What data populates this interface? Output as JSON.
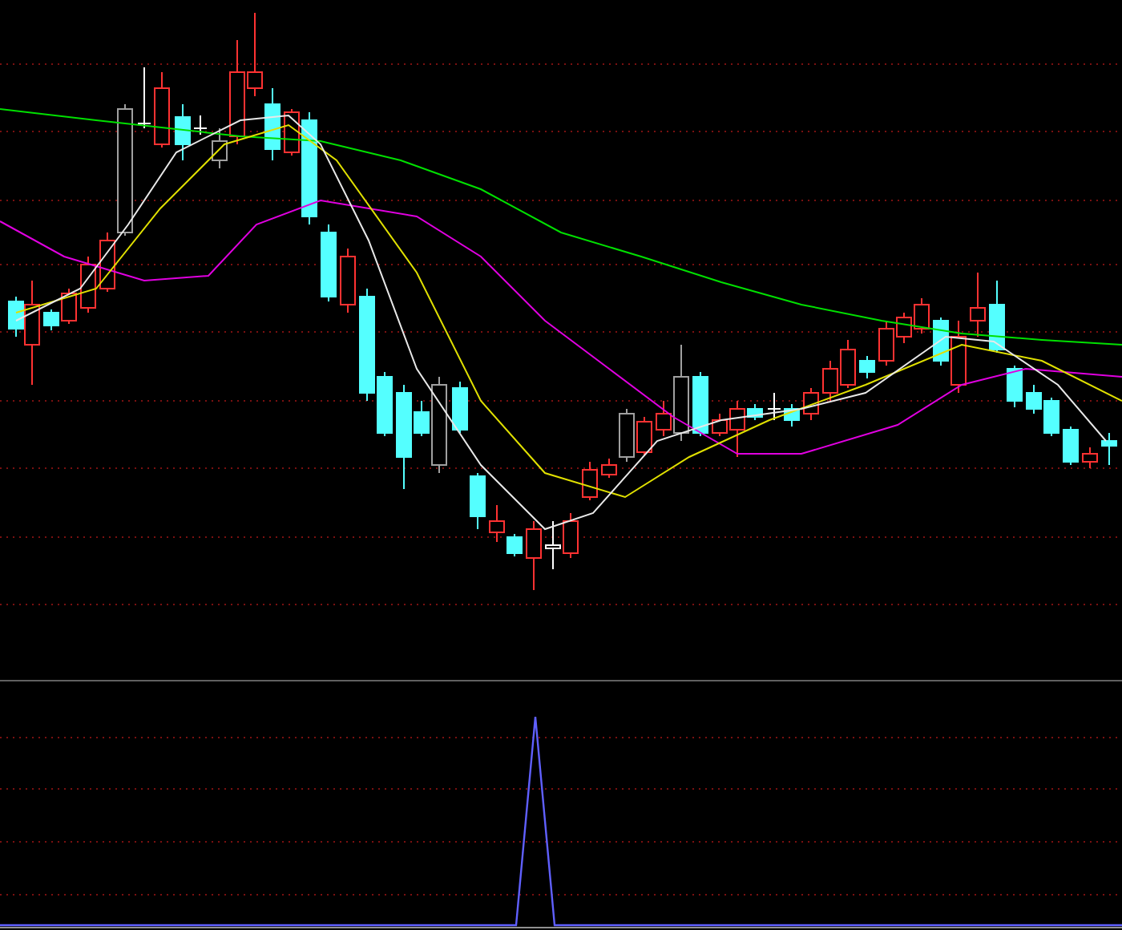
{
  "panels": [
    {
      "kind": "candlestick"
    },
    {
      "kind": "indicator"
    }
  ]
}
